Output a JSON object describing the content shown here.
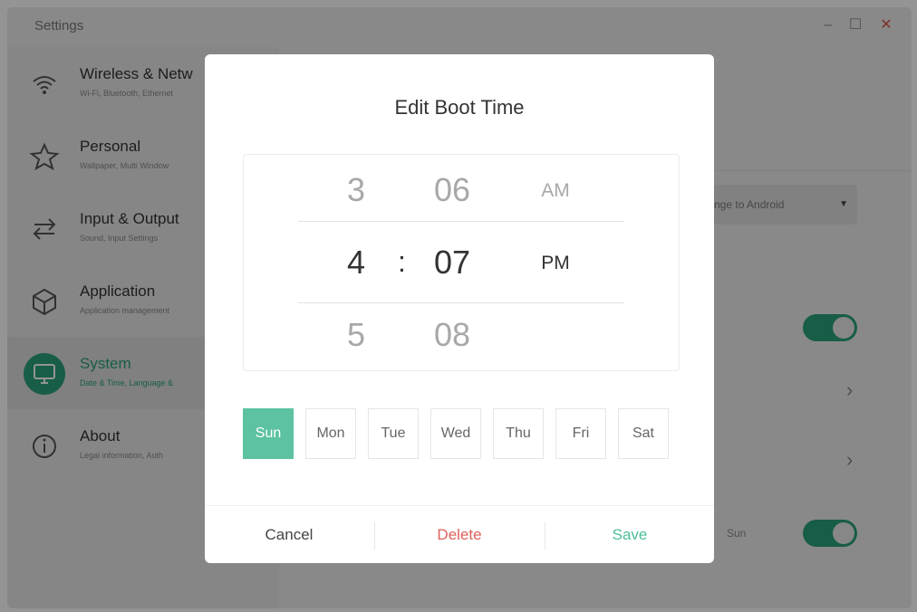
{
  "window": {
    "title": "Settings"
  },
  "sidebar": {
    "items": [
      {
        "label": "Wireless & Netw",
        "sub": "Wi-Fi, Bluetooth, Ethernet"
      },
      {
        "label": "Personal",
        "sub": "Wallpaper, Multi Window"
      },
      {
        "label": "Input & Output",
        "sub": "Sound, Input Settings"
      },
      {
        "label": "Application",
        "sub": "Application management"
      },
      {
        "label": "System",
        "sub": "Date & Time, Language &"
      },
      {
        "label": "About",
        "sub": "Legal information, Auth"
      }
    ]
  },
  "content": {
    "dropdown_value": "nge to Android",
    "sun_label": "Sun"
  },
  "dialog": {
    "title": "Edit Boot Time",
    "hours": [
      "3",
      "4",
      "5"
    ],
    "minutes": [
      "06",
      "07",
      "08"
    ],
    "ampm": [
      "AM",
      "PM"
    ],
    "separator": ":",
    "days": [
      "Sun",
      "Mon",
      "Tue",
      "Wed",
      "Thu",
      "Fri",
      "Sat"
    ],
    "selected_day": "Sun",
    "cancel": "Cancel",
    "delete": "Delete",
    "save": "Save"
  },
  "colors": {
    "accent": "#2aa07b",
    "day_selected": "#5cc2a1",
    "delete": "#e0605b",
    "save": "#4cbf98"
  }
}
